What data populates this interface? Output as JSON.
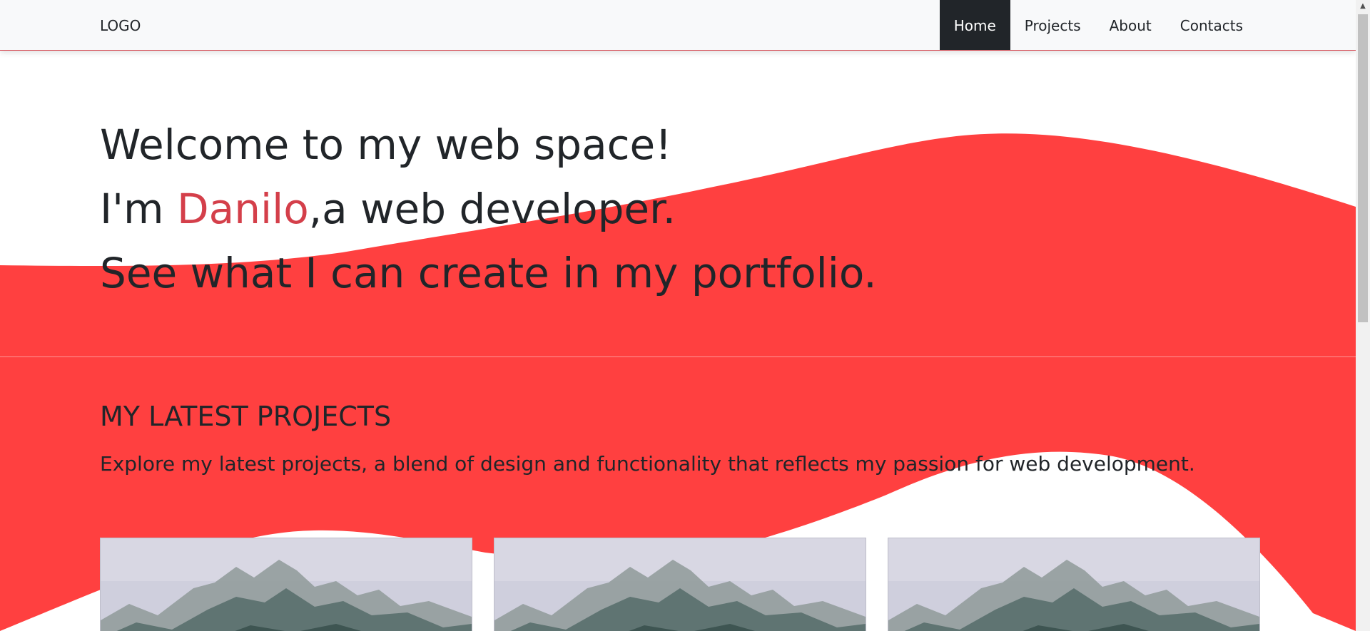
{
  "navbar": {
    "logo": "LOGO",
    "items": [
      {
        "label": "Home",
        "active": true
      },
      {
        "label": "Projects",
        "active": false
      },
      {
        "label": "About",
        "active": false
      },
      {
        "label": "Contacts",
        "active": false
      }
    ]
  },
  "hero": {
    "line1": "Welcome to my web space!",
    "line2_prefix": "I'm ",
    "line2_name": "Danilo",
    "line2_suffix": ",a web developer.",
    "line3": "See what I can create in my portfolio."
  },
  "projects": {
    "title": "MY LATEST PROJECTS",
    "description": "Explore my latest projects, a blend of design and functionality that reflects my passion for web development.",
    "cards": [
      {
        "image": "mountain-landscape-image"
      },
      {
        "image": "mountain-landscape-image"
      },
      {
        "image": "mountain-landscape-image"
      }
    ]
  },
  "colors": {
    "accent": "#d43f4a",
    "wave": "#ff4040",
    "navbar_bg": "#f8f9fa",
    "active_nav_bg": "#212529",
    "text": "#212529"
  },
  "icons": {
    "scroll_up": "triangle-up-icon",
    "scroll_down": "triangle-down-icon"
  }
}
